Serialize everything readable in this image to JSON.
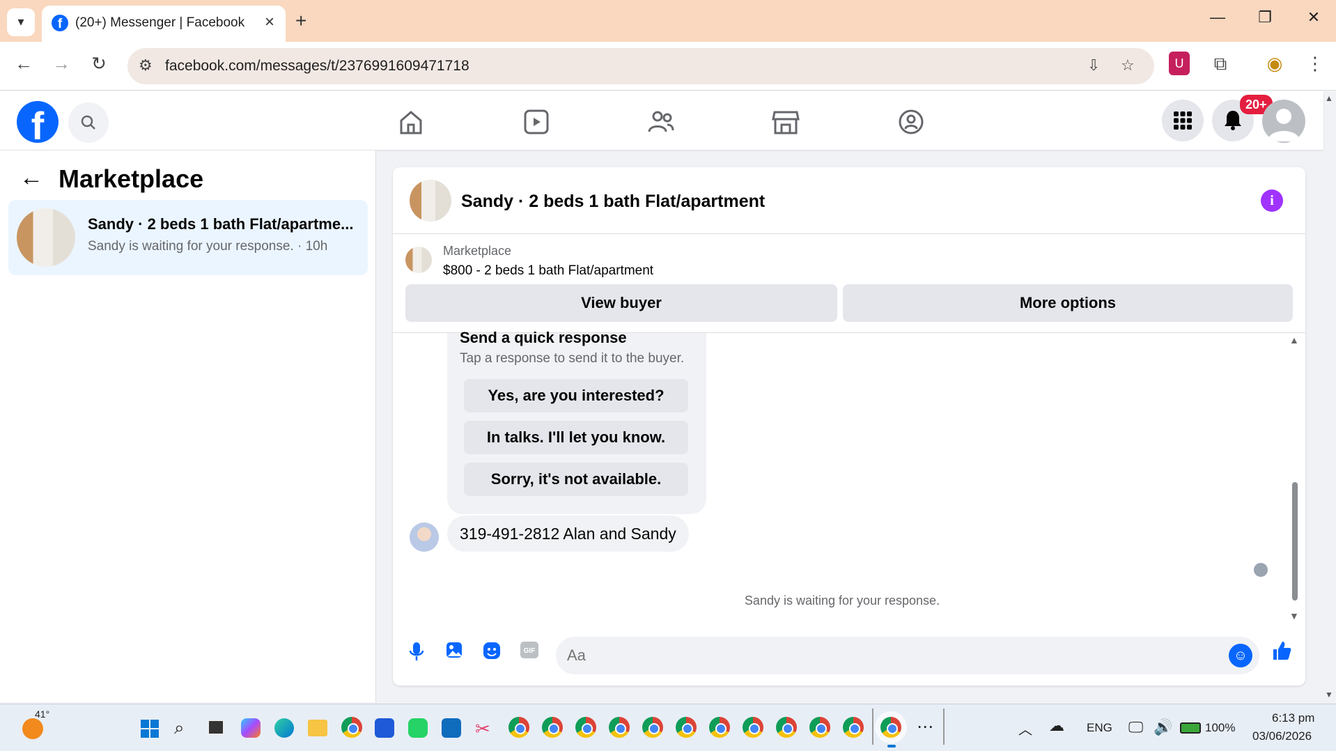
{
  "browser": {
    "tab_title": "(20+) Messenger | Facebook",
    "url": "facebook.com/messages/t/2376991609471718"
  },
  "fb_header": {
    "notification_badge": "20+"
  },
  "left_panel": {
    "title": "Marketplace",
    "conversation": {
      "name": "Sandy · 2 beds 1 bath Flat/apartme...",
      "preview": "Sandy is waiting for your response. · 10h"
    }
  },
  "chat": {
    "title": "Sandy · 2 beds 1 bath Flat/apartment",
    "listing_label": "Marketplace",
    "listing_price": "$800 - 2 beds 1 bath Flat/apartment",
    "view_buyer": "View buyer",
    "more_options": "More options",
    "quick_title": "Send a quick response",
    "quick_sub": "Tap a response to send it to the buyer.",
    "quick_responses": [
      "Yes, are you interested?",
      "In talks. I'll let you know.",
      "Sorry, it's not available."
    ],
    "message": "319-491-2812 Alan and Sandy",
    "waiting": "Sandy is waiting for your response.",
    "composer_placeholder": "Aa"
  },
  "taskbar": {
    "weather_temp": "41°",
    "lang": "ENG",
    "battery": "100%",
    "time": "6:13 pm",
    "date": "03/06/2026"
  },
  "colors": {
    "fb_blue": "#0866ff",
    "selected_conv": "#ebf5ff",
    "info_purple": "#a033ff",
    "badge_red": "#e41e3f"
  }
}
